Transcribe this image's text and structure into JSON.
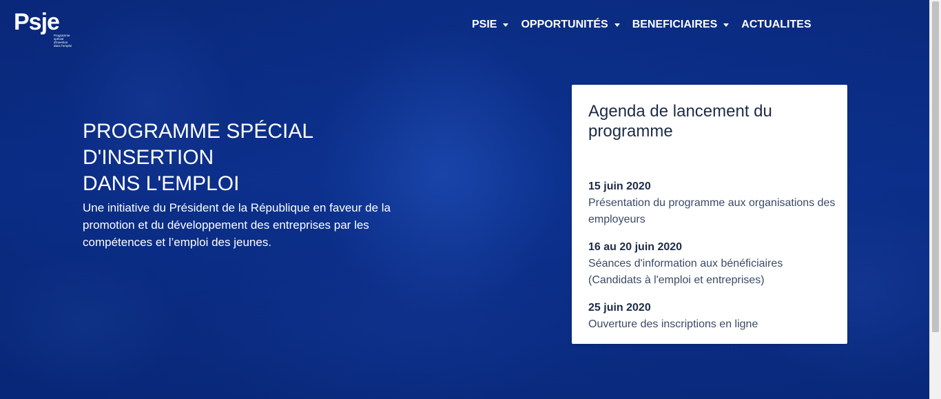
{
  "logo": {
    "text": "Psje",
    "subtitle_lines": [
      "Programme",
      "spécial",
      "d'insertion",
      "dans l'emploi"
    ]
  },
  "nav": {
    "items": [
      {
        "label": "PSIE",
        "dropdown": true
      },
      {
        "label": "OPPORTUNITÉS",
        "dropdown": true
      },
      {
        "label": "BENEFICIAIRES",
        "dropdown": true
      },
      {
        "label": "ACTUALITES",
        "dropdown": false
      }
    ]
  },
  "hero": {
    "title_lines": [
      "PROGRAMME SPÉCIAL",
      "D'INSERTION",
      "DANS L'EMPLOI"
    ],
    "description": "Une initiative du Président de la République en faveur de la promotion et du développement des entreprises par les compétences et l’emploi des jeunes."
  },
  "agenda": {
    "title": "Agenda de lancement du programme",
    "items": [
      {
        "date": "15 juin 2020",
        "text": "Présentation du programme aux organisations des employeurs"
      },
      {
        "date": "16 au 20 juin 2020",
        "text": "Séances d'information aux bénéficiaires (Candidats à l'emploi et entreprises)"
      },
      {
        "date": "25 juin 2020",
        "text": "Ouverture des inscriptions en ligne"
      }
    ]
  },
  "colors": {
    "hero_background": "#0a2f8c",
    "card_background": "#ffffff",
    "card_title": "#1c2b45",
    "nav_text": "#ffffff"
  },
  "icons": {
    "dropdown": "caret-down-icon"
  }
}
